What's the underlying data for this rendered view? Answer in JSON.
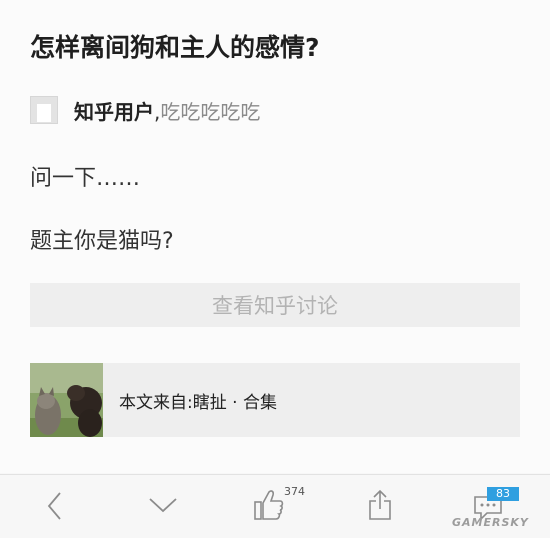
{
  "question": {
    "title": "怎样离间狗和主人的感情?"
  },
  "answer": {
    "author_name": "知乎用户",
    "separator": ",",
    "author_bio": "吃吃吃吃吃",
    "paragraphs": [
      "问一下……",
      "题主你是猫吗?"
    ]
  },
  "view_discussion_label": "查看知乎讨论",
  "source": {
    "label": "本文来自:瞎扯 · 合集"
  },
  "bottom_bar": {
    "vote_count": "374",
    "comment_count": "83"
  },
  "watermark": "GAMERSKY",
  "colors": {
    "badge": "#2f9fe0",
    "background": "#f7f7f7",
    "button_bg": "#eeeeee"
  },
  "icons": [
    "back-icon",
    "down-icon",
    "thumbs-up-icon",
    "share-icon",
    "comment-icon"
  ]
}
